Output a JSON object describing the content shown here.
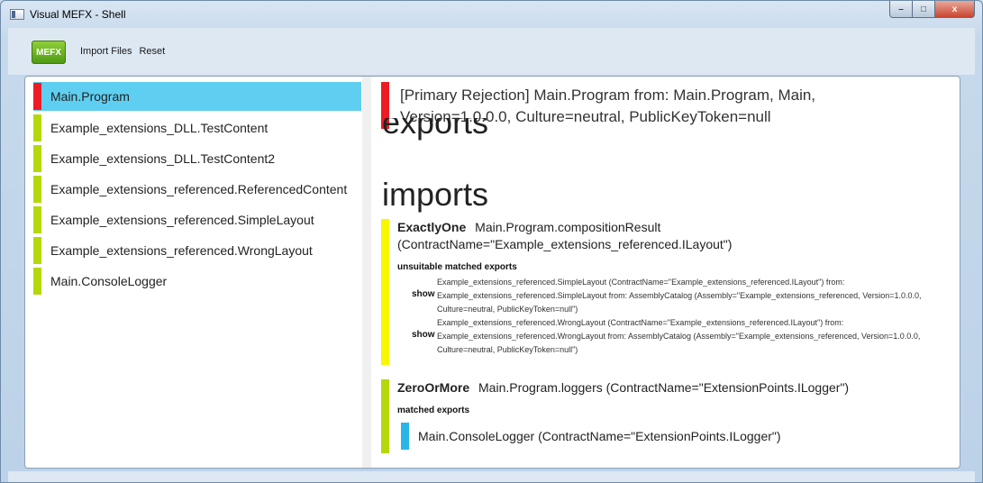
{
  "window": {
    "title": "Visual MEFX - Shell",
    "controls": {
      "minimize": "–",
      "maximize": "□",
      "close": "x"
    }
  },
  "toolbar": {
    "logo": "MEFX",
    "import_files": "Import Files",
    "reset": "Reset"
  },
  "parts": [
    {
      "label": "Main.Program",
      "status_color": "#ed1c24",
      "selected": true
    },
    {
      "label": "Example_extensions_DLL.TestContent",
      "status_color": "#b5d80a"
    },
    {
      "label": "Example_extensions_DLL.TestContent2",
      "status_color": "#b5d80a"
    },
    {
      "label": "Example_extensions_referenced.ReferencedContent",
      "status_color": "#b5d80a"
    },
    {
      "label": "Example_extensions_referenced.SimpleLayout",
      "status_color": "#b5d80a"
    },
    {
      "label": "Example_extensions_referenced.WrongLayout",
      "status_color": "#b5d80a"
    },
    {
      "label": "Main.ConsoleLogger",
      "status_color": "#b5d80a"
    }
  ],
  "detail": {
    "rejection": "[Primary Rejection] Main.Program from: Main.Program, Main, Version=1.0.0.0, Culture=neutral, PublicKeyToken=null",
    "exports_heading": "exports",
    "imports_heading": "imports",
    "imports": [
      {
        "cardinality": "ExactlyOne",
        "description": "Main.Program.compositionResult (ContractName=\"Example_extensions_referenced.ILayout\")",
        "bar_color": "#f7f700",
        "sub_heading": "unsuitable matched exports",
        "exports": [
          {
            "show": "show",
            "text": "Example_extensions_referenced.SimpleLayout (ContractName=\"Example_extensions_referenced.ILayout\") from: Example_extensions_referenced.SimpleLayout from: AssemblyCatalog (Assembly=\"Example_extensions_referenced, Version=1.0.0.0, Culture=neutral, PublicKeyToken=null\")"
          },
          {
            "show": "show",
            "text": "Example_extensions_referenced.WrongLayout (ContractName=\"Example_extensions_referenced.ILayout\") from: Example_extensions_referenced.WrongLayout from: AssemblyCatalog (Assembly=\"Example_extensions_referenced, Version=1.0.0.0, Culture=neutral, PublicKeyToken=null\")"
          }
        ]
      },
      {
        "cardinality": "ZeroOrMore",
        "description": "Main.Program.loggers (ContractName=\"ExtensionPoints.ILogger\")",
        "bar_color": "#b5d80a",
        "sub_heading": "matched exports",
        "matched": "Main.ConsoleLogger (ContractName=\"ExtensionPoints.ILogger\")",
        "matched_color": "#29b6e6"
      }
    ]
  }
}
